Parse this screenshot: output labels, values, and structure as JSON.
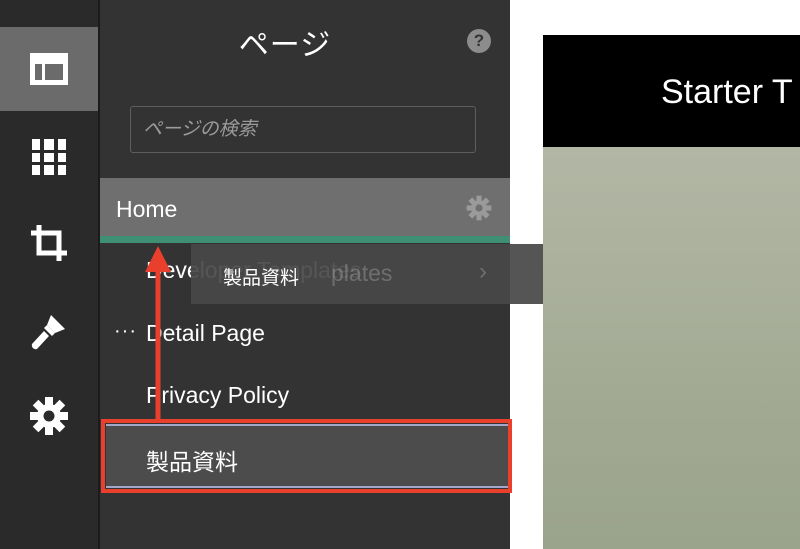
{
  "sidebar": {
    "items": [
      {
        "icon": "layout-icon",
        "active": true
      },
      {
        "icon": "columns-icon",
        "active": false
      },
      {
        "icon": "crop-icon",
        "active": false
      },
      {
        "icon": "paintbrush-icon",
        "active": false
      },
      {
        "icon": "gear-icon",
        "active": false
      }
    ]
  },
  "panel": {
    "title": "ページ",
    "help_label": "?",
    "search_placeholder": "ページの検索",
    "pages": {
      "home": "Home",
      "developer": "Developer Templates",
      "detail": "Detail Page",
      "detail_menu": "···",
      "privacy": "Privacy Policy",
      "product": "製品資料"
    }
  },
  "drag": {
    "label": "製品資料",
    "behind_text": "Developer Templates",
    "chevron": "›"
  },
  "preview": {
    "title": "Starter T"
  },
  "colors": {
    "rail_bg": "#2a2a2a",
    "panel_bg": "#333333",
    "active_rail": "#6b6b6b",
    "accent_green": "#3f8f74",
    "highlight_red": "#e8402c"
  }
}
